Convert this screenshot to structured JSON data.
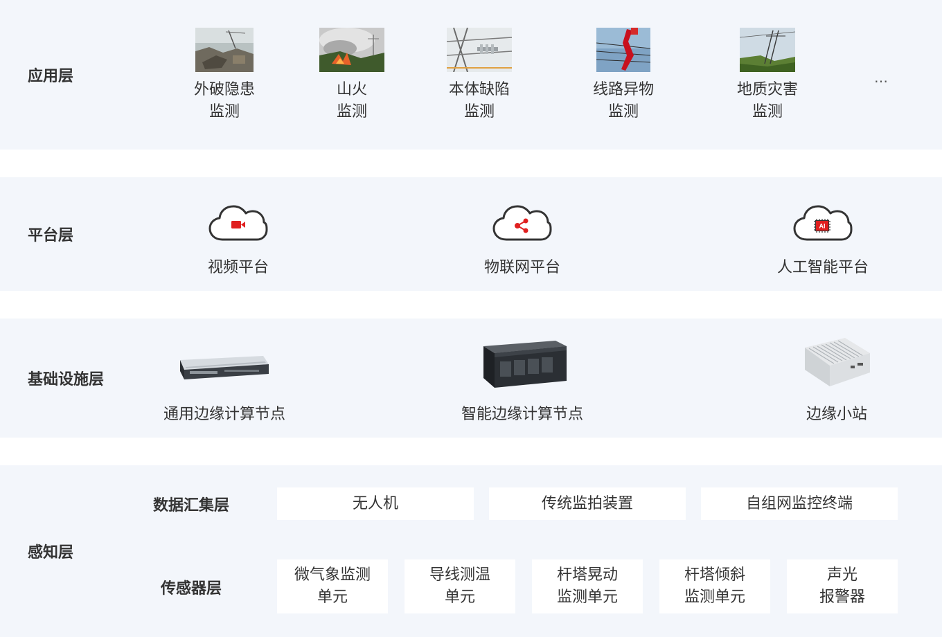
{
  "layers": {
    "application": {
      "label": "应用层",
      "items": [
        {
          "line1": "外破隐患",
          "line2": "监测",
          "photo": "construction-site"
        },
        {
          "line1": "山火",
          "line2": "监测",
          "photo": "wildfire"
        },
        {
          "line1": "本体缺陷",
          "line2": "监测",
          "photo": "tower-insulator"
        },
        {
          "line1": "线路异物",
          "line2": "监测",
          "photo": "foreign-object-on-line"
        },
        {
          "line1": "地质灾害",
          "line2": "监测",
          "photo": "tower-on-hillside"
        }
      ],
      "more": "…"
    },
    "platform": {
      "label": "平台层",
      "items": [
        {
          "label": "视频平台",
          "icon": "cloud-video-icon"
        },
        {
          "label": "物联网平台",
          "icon": "cloud-iot-icon"
        },
        {
          "label": "人工智能平台",
          "icon": "cloud-ai-icon",
          "chip_text": "AI"
        }
      ]
    },
    "infrastructure": {
      "label": "基础设施层",
      "items": [
        {
          "label": "通用边缘计算节点",
          "image": "rack-server-1u"
        },
        {
          "label": "智能边缘计算节点",
          "image": "rack-server-4u"
        },
        {
          "label": "边缘小站",
          "image": "fanless-box"
        }
      ]
    },
    "perception": {
      "label": "感知层",
      "collection": {
        "label": "数据汇集层",
        "items": [
          "无人机",
          "传统监拍装置",
          "自组网监控终端"
        ]
      },
      "sensor": {
        "label": "传感器层",
        "items": [
          {
            "line1": "微气象监测",
            "line2": "单元"
          },
          {
            "line1": "导线测温",
            "line2": "单元"
          },
          {
            "line1": "杆塔晃动",
            "line2": "监测单元"
          },
          {
            "line1": "杆塔倾斜",
            "line2": "监测单元"
          },
          {
            "line1": "声光",
            "line2": "报警器"
          }
        ]
      }
    }
  },
  "colors": {
    "band": "#f3f6fb",
    "accent_red": "#e02020",
    "icon_outline": "#333333",
    "text": "#333333"
  }
}
